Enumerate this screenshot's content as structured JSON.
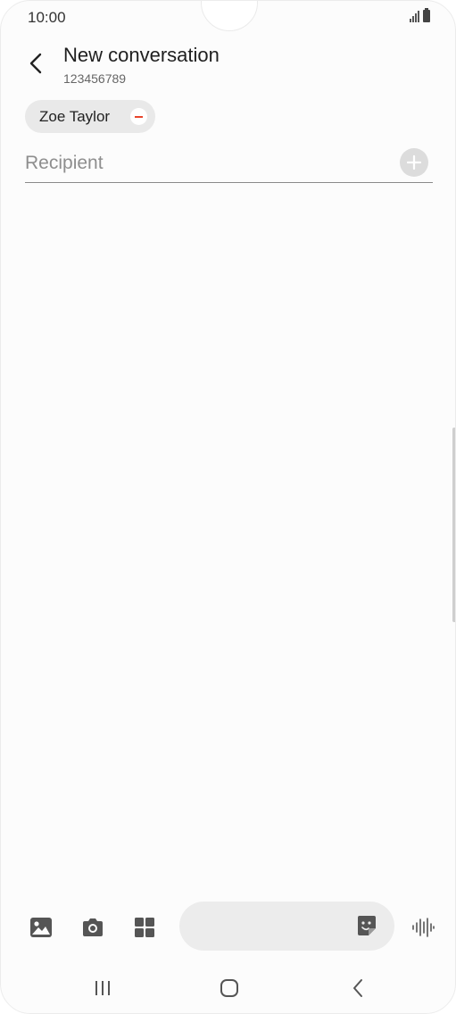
{
  "status_bar": {
    "time": "10:00"
  },
  "header": {
    "title": "New conversation",
    "subtitle": "123456789",
    "back_icon": "chevron-left-icon"
  },
  "recipients": {
    "chips": [
      {
        "label": "Zoe Taylor",
        "remove_icon": "minus-circle-icon"
      }
    ],
    "input_placeholder": "Recipient",
    "input_value": "",
    "add_icon": "plus-circle-icon"
  },
  "composer": {
    "gallery_icon": "image-icon",
    "camera_icon": "camera-icon",
    "apps_icon": "grid-icon",
    "message_value": "",
    "sticker_icon": "sticker-icon",
    "voice_icon": "voice-wave-icon"
  },
  "nav_bar": {
    "recents_icon": "recents-icon",
    "home_icon": "home-icon",
    "back_icon": "back-icon"
  },
  "colors": {
    "chip_remove": "#e8452c",
    "icon_gray": "#555555",
    "background": "#fcfcfc"
  }
}
